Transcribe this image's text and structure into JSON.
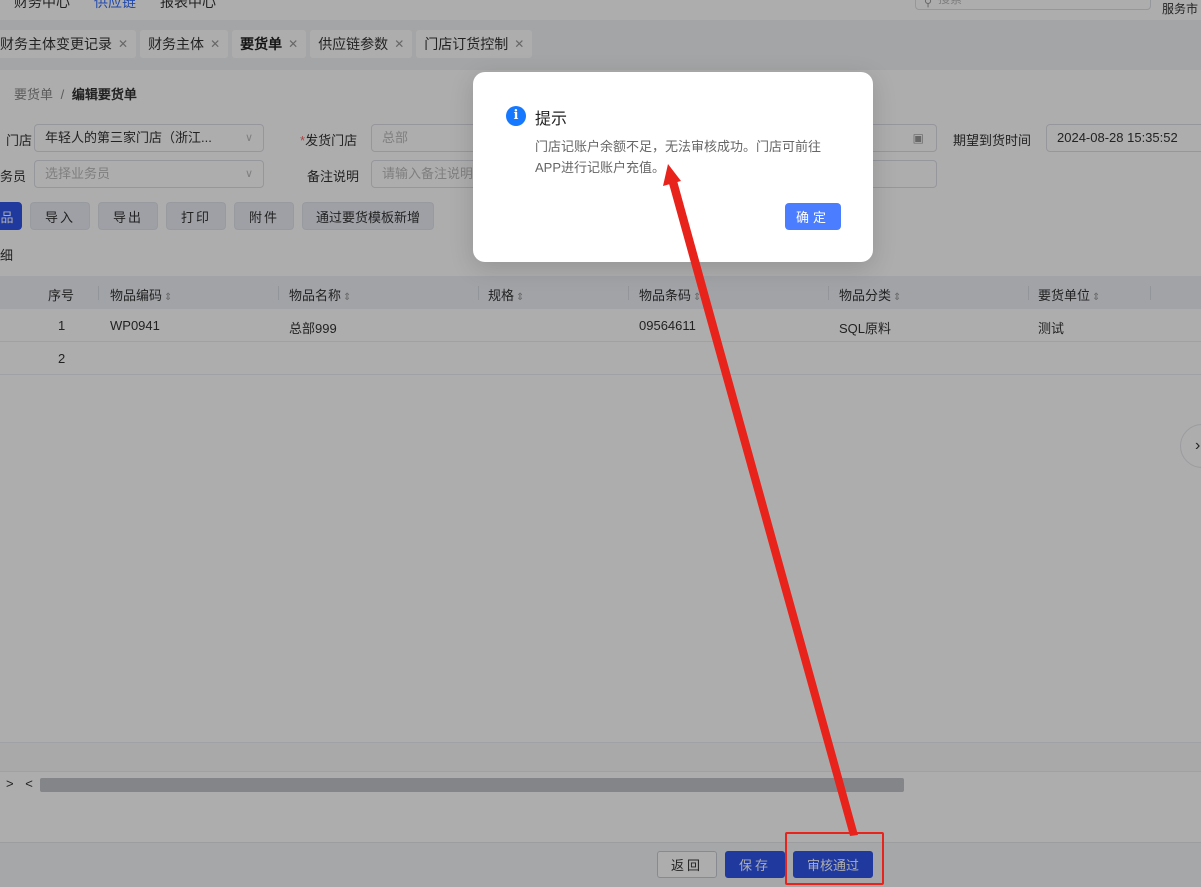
{
  "topbar": {
    "nav": [
      "财务中心",
      "供应链",
      "报表中心"
    ],
    "search_placeholder": "搜索",
    "service_text": "服务市"
  },
  "tabs": [
    {
      "label": "财务主体变更记录",
      "active": false
    },
    {
      "label": "财务主体",
      "active": false
    },
    {
      "label": "要货单",
      "active": true
    },
    {
      "label": "供应链参数",
      "active": false
    },
    {
      "label": "门店订货控制",
      "active": false
    }
  ],
  "breadcrumb": {
    "parent": "要货单",
    "separator": "/",
    "current": "编辑要货单"
  },
  "form": {
    "store_label": "门店",
    "store_value": "年轻人的第三家门店（浙江...",
    "ship_store_label": "发货门店",
    "ship_store_value": "总部",
    "expected_time_label": "期望到货时间",
    "expected_time_value": "2024-08-28 15:35:52",
    "salesman_label": "务员",
    "salesman_placeholder": "选择业务员",
    "remark_label": "备注说明",
    "remark_placeholder": "请输入备注说明"
  },
  "toolbar": {
    "add_item": "品",
    "import": "导入",
    "export": "导出",
    "print": "打印",
    "attachment": "附件",
    "template_add": "通过要货模板新增"
  },
  "detail_label": "细",
  "table": {
    "columns": [
      "序号",
      "物品编码",
      "物品名称",
      "规格",
      "物品条码",
      "物品分类",
      "要货单位"
    ],
    "rows": [
      [
        "1",
        "WP0941",
        "总部999",
        "",
        "09564611",
        "SQL原料",
        "测试"
      ],
      [
        "2",
        "",
        "",
        "",
        "",
        "",
        ""
      ]
    ]
  },
  "scroll_nav": "> <",
  "side_toggle": "›",
  "bottom": {
    "back": "返回",
    "save": "保存",
    "approve": "审核通过"
  },
  "dialog": {
    "title": "提示",
    "message": "门店记账户余额不足，无法审核成功。门店可前往APP进行记账户充值。",
    "ok": "确定"
  },
  "colors": {
    "primary": "#2f54eb",
    "info": "#1677ff",
    "annotation": "#e8231c"
  }
}
